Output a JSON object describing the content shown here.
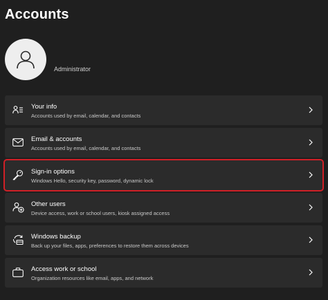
{
  "page": {
    "title": "Accounts",
    "username": "Administrator"
  },
  "colors": {
    "background": "#1f1f1f",
    "card": "#2b2b2b",
    "highlight_border": "#d12027",
    "avatar_bg": "#eeeeee"
  },
  "items": [
    {
      "title": "Your info",
      "subtitle": "Accounts used by email, calendar, and contacts",
      "icon": "person-card-icon"
    },
    {
      "title": "Email & accounts",
      "subtitle": "Accounts used by email, calendar, and contacts",
      "icon": "mail-icon"
    },
    {
      "title": "Sign-in options",
      "subtitle": "Windows Hello, security key, password, dynamic lock",
      "icon": "key-icon",
      "highlighted": true
    },
    {
      "title": "Other users",
      "subtitle": "Device access, work or school users, kiosk assigned access",
      "icon": "people-add-icon"
    },
    {
      "title": "Windows backup",
      "subtitle": "Back up your files, apps, preferences to restore them across devices",
      "icon": "backup-icon"
    },
    {
      "title": "Access work or school",
      "subtitle": "Organization resources like email, apps, and network",
      "icon": "briefcase-icon"
    }
  ]
}
